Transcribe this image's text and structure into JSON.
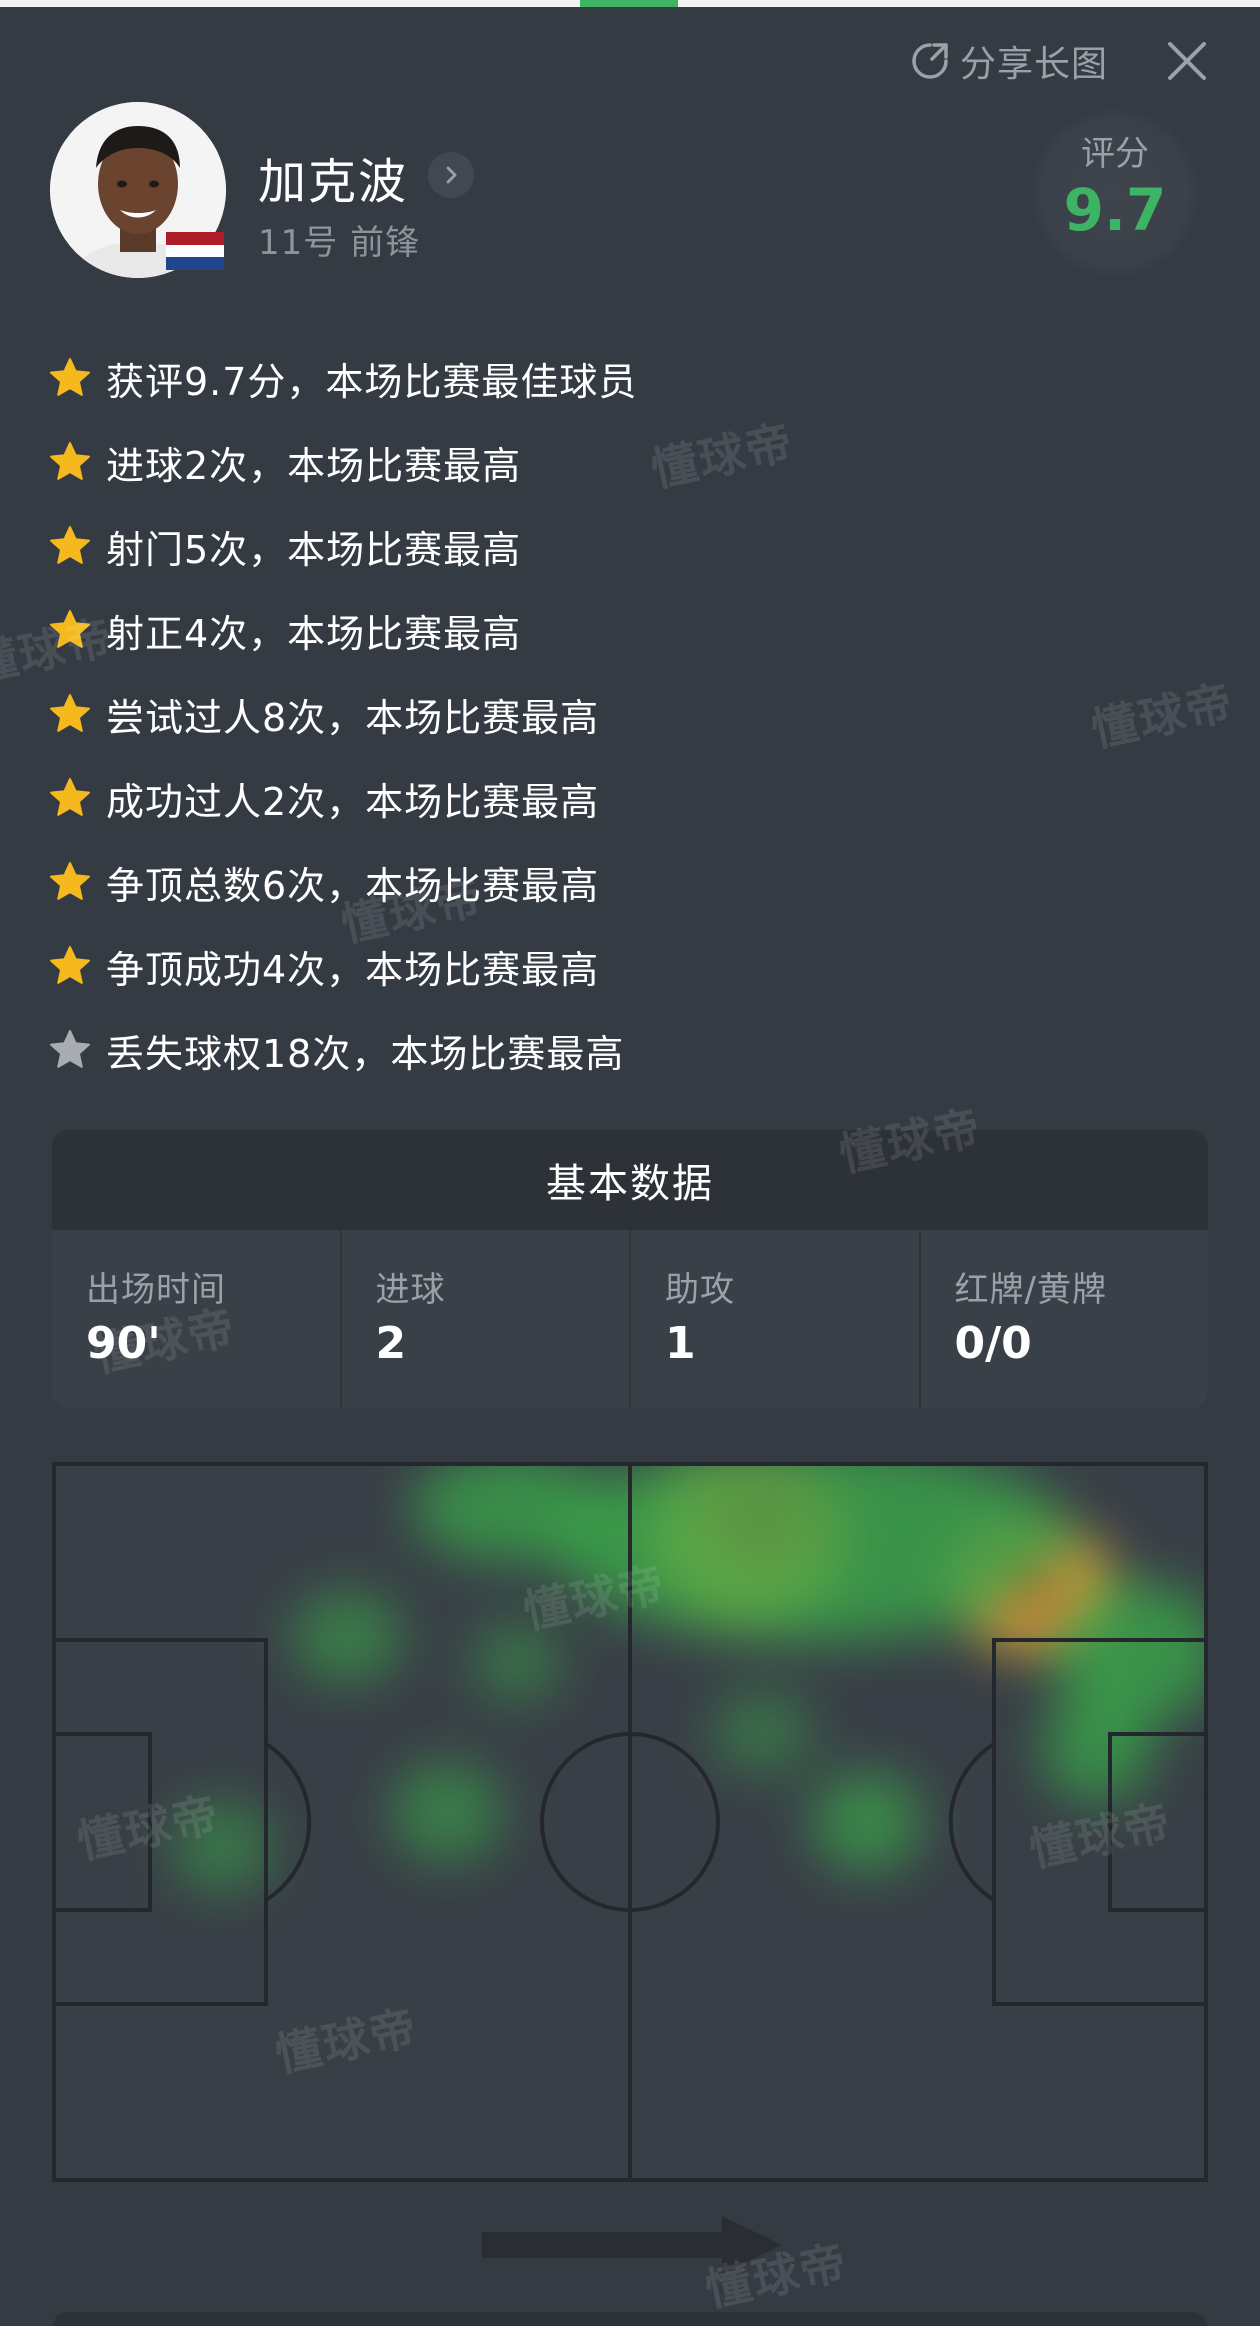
{
  "header": {
    "share_label": "分享长图",
    "share_icon": "share-icon",
    "close_icon": "close-icon"
  },
  "player": {
    "name": "加克波",
    "number_position": "11号 前锋",
    "flag": "netherlands-flag",
    "rating_label": "评分",
    "rating_value": "9.7"
  },
  "highlights": [
    {
      "text": "获评9.7分，本场比赛最佳球员",
      "star": "gold"
    },
    {
      "text": "进球2次，本场比赛最高",
      "star": "gold"
    },
    {
      "text": "射门5次，本场比赛最高",
      "star": "gold"
    },
    {
      "text": "射正4次，本场比赛最高",
      "star": "gold"
    },
    {
      "text": "尝试过人8次，本场比赛最高",
      "star": "gold"
    },
    {
      "text": "成功过人2次，本场比赛最高",
      "star": "gold"
    },
    {
      "text": "争顶总数6次，本场比赛最高",
      "star": "gold"
    },
    {
      "text": "争顶成功4次，本场比赛最高",
      "star": "gold"
    },
    {
      "text": "丢失球权18次，本场比赛最高",
      "star": "silver"
    }
  ],
  "basic_stats": {
    "title": "基本数据",
    "items": [
      {
        "label": "出场时间",
        "value": "90'"
      },
      {
        "label": "进球",
        "value": "2"
      },
      {
        "label": "助攻",
        "value": "1"
      },
      {
        "label": "红牌/黄牌",
        "value": "0/0"
      }
    ]
  },
  "watermark": "懂球帝",
  "colors": {
    "background": "#353b43",
    "accent_green": "#3cb463",
    "star_gold": "#f5b91e",
    "star_silver": "#a9adb2",
    "heat_low": "#3aa84a",
    "heat_mid": "#e0c43a",
    "heat_high": "#e2532a"
  }
}
